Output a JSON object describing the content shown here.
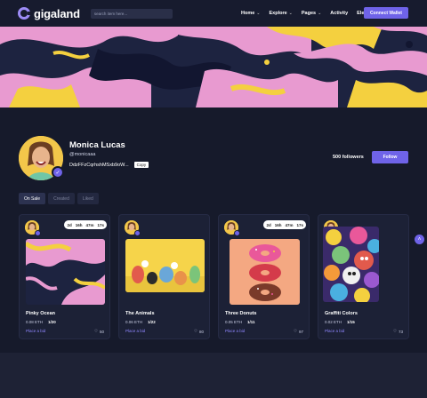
{
  "header": {
    "logo_text": "gigaland",
    "search_placeholder": "search item here...",
    "nav": [
      {
        "label": "Home",
        "has_dropdown": true
      },
      {
        "label": "Explore",
        "has_dropdown": true
      },
      {
        "label": "Pages",
        "has_dropdown": true
      },
      {
        "label": "Activity",
        "has_dropdown": false
      },
      {
        "label": "Elements",
        "has_dropdown": true
      }
    ],
    "connect_label": "Connect Wallet"
  },
  "profile": {
    "name": "Monica Lucas",
    "handle": "@monicaaa",
    "address": "DdzFFzCqrhshMSxb9oW...",
    "copy_label": "Copy",
    "followers": "500 followers",
    "follow_label": "Follow"
  },
  "tabs": [
    {
      "label": "On Sale",
      "active": true
    },
    {
      "label": "Created",
      "active": false
    },
    {
      "label": "Liked",
      "active": false
    }
  ],
  "cards": [
    {
      "title": "Pinky Ocean",
      "price": "0.08 ETH",
      "stock": "1/20",
      "bid_label": "Place a bid",
      "likes": "50",
      "timer": [
        "2d",
        "16h",
        "47m",
        "17s"
      ]
    },
    {
      "title": "The Animals",
      "price": "0.06 ETH",
      "stock": "1/22",
      "bid_label": "Place a bid",
      "likes": "80",
      "timer": null
    },
    {
      "title": "Three Donuts",
      "price": "0.05 ETH",
      "stock": "1/11",
      "bid_label": "Place a bid",
      "likes": "97",
      "timer": [
        "2d",
        "16h",
        "47m",
        "17s"
      ]
    },
    {
      "title": "Graffiti Colors",
      "price": "0.02 ETH",
      "stock": "1/15",
      "bid_label": "Place a bid",
      "likes": "73",
      "timer": null
    }
  ],
  "colors": {
    "accent": "#6f63e8",
    "background": "#161a2b",
    "card": "#1c2136"
  }
}
